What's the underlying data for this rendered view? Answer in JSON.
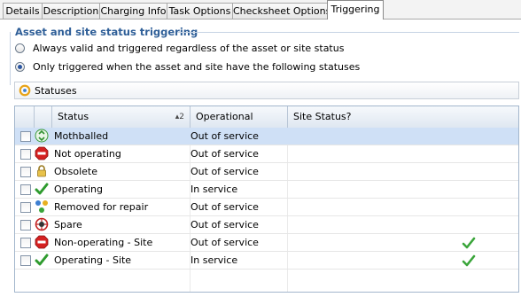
{
  "tabs": [
    "Details",
    "Description",
    "Charging Info",
    "Task Options",
    "Checksheet Options",
    "Triggering"
  ],
  "active_tab": "Triggering",
  "section": {
    "title": "Asset and site status triggering",
    "option_always": "Always valid and triggered regardless of the asset or site status",
    "option_only": "Only triggered when the asset and site have the following statuses",
    "selected_option": "option_only"
  },
  "statuses_bar": {
    "label": "Statuses"
  },
  "grid": {
    "columns": {
      "status": "Status",
      "sort_indicator": "▴2",
      "operational": "Operational",
      "site_status": "Site Status?"
    },
    "rows": [
      {
        "status": "Mothballed",
        "operational": "Out of service",
        "site_status": false,
        "icon": "recycle-icon",
        "selected": true
      },
      {
        "status": "Not operating",
        "operational": "Out of service",
        "site_status": false,
        "icon": "stop-sign-icon"
      },
      {
        "status": "Obsolete",
        "operational": "Out of service",
        "site_status": false,
        "icon": "padlock-icon"
      },
      {
        "status": "Operating",
        "operational": "In service",
        "site_status": false,
        "icon": "green-check-icon"
      },
      {
        "status": "Removed for repair",
        "operational": "Out of service",
        "site_status": false,
        "icon": "parts-icon"
      },
      {
        "status": "Spare",
        "operational": "Out of service",
        "site_status": false,
        "icon": "wheel-icon"
      },
      {
        "status": "Non-operating - Site",
        "operational": "Out of service",
        "site_status": true,
        "icon": "stop-sign-icon"
      },
      {
        "status": "Operating - Site",
        "operational": "In service",
        "site_status": true,
        "icon": "green-check-icon"
      }
    ]
  },
  "colors": {
    "accent": "#2f5f98",
    "selected_row": "#cfe0f6",
    "check_green": "#3aa53a",
    "stop_red": "#d42020"
  }
}
